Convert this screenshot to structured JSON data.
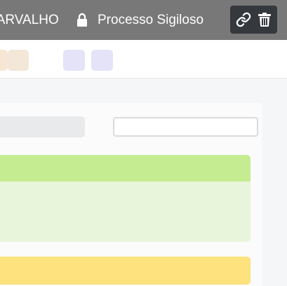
{
  "header": {
    "client_name": "CARVALHO",
    "secret_label": "Processo Sigiloso",
    "background": "#787878",
    "icons": {
      "lock": "lock-icon",
      "link": "link-icon",
      "trash": "trash-icon"
    }
  },
  "toolbar": {
    "chips": [
      {
        "color": "#f7e6d4"
      },
      {
        "color": "#f3e7d8"
      },
      {
        "color": "#e4e3f7"
      },
      {
        "color": "#e4e3f7"
      }
    ]
  },
  "search": {
    "value": "",
    "placeholder": ""
  },
  "colors": {
    "green_header": "#c5ec91",
    "green_body": "#e8f5da",
    "yellow_header": "#fde27e",
    "action_group": "#35383d"
  }
}
